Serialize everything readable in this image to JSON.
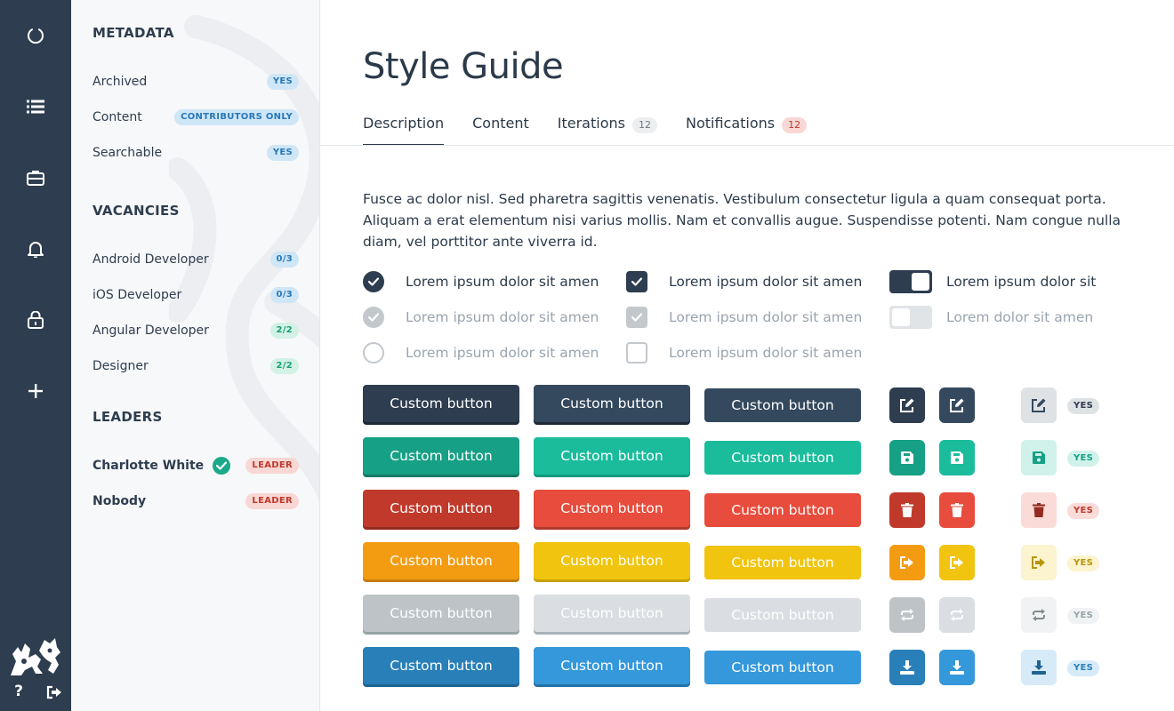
{
  "sidebar": {
    "metadata": {
      "title": "METADATA",
      "rows": [
        {
          "label": "Archived",
          "badge": "YES"
        },
        {
          "label": "Content",
          "badge": "CONTRIBUTORS ONLY"
        },
        {
          "label": "Searchable",
          "badge": "YES"
        }
      ]
    },
    "vacancies": {
      "title": "VACANCIES",
      "rows": [
        {
          "label": "Android Developer",
          "badge": "0/3"
        },
        {
          "label": "iOS Developer",
          "badge": "0/3"
        },
        {
          "label": "Angular Developer",
          "badge": "2/2"
        },
        {
          "label": "Designer",
          "badge": "2/2"
        }
      ]
    },
    "leaders": {
      "title": "LEADERS",
      "rows": [
        {
          "label": "Charlotte White",
          "badge": "LEADER"
        },
        {
          "label": "Nobody",
          "badge": "LEADER"
        }
      ]
    }
  },
  "rail": {
    "icons": [
      "circle-notch-icon",
      "list-icon",
      "briefcase-icon",
      "bell-icon",
      "lock-icon",
      "plus-icon"
    ],
    "help_label": "?"
  },
  "main": {
    "title": "Style Guide",
    "tabs": [
      {
        "label": "Description",
        "count": ""
      },
      {
        "label": "Content",
        "count": ""
      },
      {
        "label": "Iterations",
        "count": "12"
      },
      {
        "label": "Notifications",
        "count": "12"
      }
    ],
    "description": "Fusce ac dolor nisl. Sed pharetra sagittis venenatis. Vestibulum consectetur ligula a quam consequat porta. Aliquam a erat elementum nisi varius mollis. Nam et convallis augue. Suspendisse potenti. Nam congue nulla diam, vel porttitor ante viverra id.",
    "radios": [
      "Lorem ipsum dolor sit amen",
      "Lorem ipsum dolor sit amen",
      "Lorem ipsum dolor sit amen"
    ],
    "checkboxes": [
      "Lorem ipsum dolor sit amen",
      "Lorem ipsum dolor sit amen",
      "Lorem ipsum dolor sit amen"
    ],
    "toggles": [
      "Lorem ipsum dolor sit",
      "Lorem dolor sit amen"
    ],
    "button_label": "Custom button",
    "yes_label": "YES"
  },
  "colors": {
    "dark": "#2e3d4f",
    "green": "#1abc9c",
    "red": "#e74c3c",
    "yellow": "#f1c40f",
    "grey": "#dadde1",
    "blue": "#3498db"
  }
}
